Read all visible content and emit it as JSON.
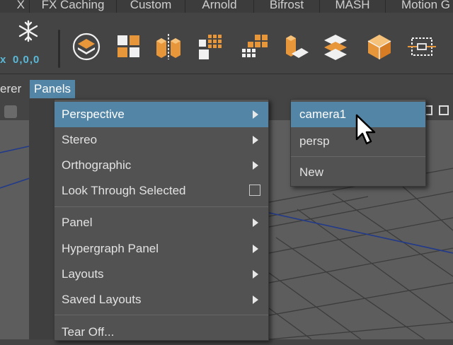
{
  "shelf_tabs": [
    "X",
    "FX Caching",
    "Custom",
    "Arnold",
    "Bifrost",
    "MASH",
    "Motion G"
  ],
  "shelf": {
    "snow_label": "0,0,0",
    "left_label": "x",
    "icons": [
      "snowflake-icon",
      "layers-circle-icon",
      "quad-blocks-icon",
      "split-cubes-icon",
      "grid-dots-icon",
      "grid-cubes-icon",
      "stacked-blocks-icon",
      "rotated-planes-icon",
      "cube-icon",
      "bounding-box-icon"
    ]
  },
  "menubar": {
    "left_fragment": "erer",
    "panels": "Panels"
  },
  "panels_menu": {
    "items": [
      {
        "label": "Perspective",
        "submenu": true
      },
      {
        "label": "Stereo",
        "submenu": true
      },
      {
        "label": "Orthographic",
        "submenu": true
      },
      {
        "label": "Look Through Selected",
        "checkbox": true
      },
      {
        "label": "Panel",
        "submenu": true
      },
      {
        "label": "Hypergraph Panel",
        "submenu": true
      },
      {
        "label": "Layouts",
        "submenu": true
      },
      {
        "label": "Saved Layouts",
        "submenu": true
      },
      {
        "label": "Tear Off..."
      }
    ]
  },
  "perspective_submenu": {
    "items": [
      {
        "label": "camera1"
      },
      {
        "label": "persp"
      },
      {
        "label": "New"
      }
    ]
  },
  "colors": {
    "highlight": "#5285a6",
    "accent_orange": "#e8963a",
    "menu_bg": "#525252"
  }
}
